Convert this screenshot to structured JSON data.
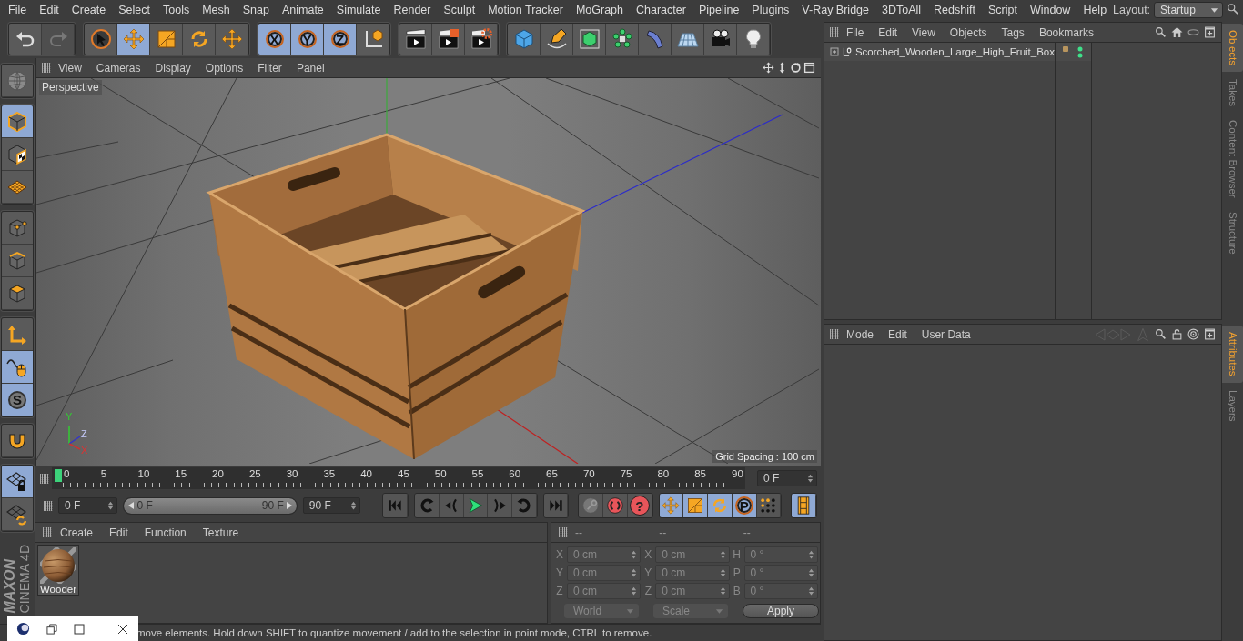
{
  "menu_bar": {
    "items": [
      "File",
      "Edit",
      "Create",
      "Select",
      "Tools",
      "Mesh",
      "Snap",
      "Animate",
      "Simulate",
      "Render",
      "Sculpt",
      "Motion Tracker",
      "MoGraph",
      "Character",
      "Pipeline",
      "Plugins",
      "V-Ray Bridge",
      "3DToAll",
      "Redshift",
      "Script",
      "Window",
      "Help"
    ],
    "layout_label": "Layout:",
    "layout_value": "Startup"
  },
  "toolbar": {
    "groups": [
      {
        "tools": [
          {
            "kind": "undo",
            "selected": false,
            "disabled": false
          },
          {
            "kind": "redo",
            "selected": false,
            "disabled": true
          }
        ]
      },
      {
        "tools": [
          {
            "kind": "select",
            "selected": false,
            "disabled": false
          },
          {
            "kind": "move",
            "selected": true,
            "disabled": false
          },
          {
            "kind": "scale",
            "selected": false,
            "disabled": false
          },
          {
            "kind": "rotate",
            "selected": false,
            "disabled": false
          },
          {
            "kind": "recent",
            "selected": false,
            "disabled": false
          }
        ]
      },
      {
        "tools": [
          {
            "kind": "axis",
            "label": "X",
            "selected": true,
            "disabled": false
          },
          {
            "kind": "axis",
            "label": "Y",
            "selected": true,
            "disabled": false
          },
          {
            "kind": "axis",
            "label": "Z",
            "selected": true,
            "disabled": false
          },
          {
            "kind": "coord",
            "selected": false,
            "disabled": false
          }
        ]
      },
      {
        "tools": [
          {
            "kind": "render",
            "selected": false,
            "disabled": false
          },
          {
            "kind": "render-viewer",
            "selected": false,
            "disabled": false
          },
          {
            "kind": "render-settings",
            "selected": false,
            "disabled": false
          }
        ]
      },
      {
        "tools": [
          {
            "kind": "cube",
            "selected": false,
            "disabled": false
          },
          {
            "kind": "pen",
            "selected": false,
            "disabled": false
          },
          {
            "kind": "subdiv",
            "selected": false,
            "disabled": false
          },
          {
            "kind": "cloner",
            "selected": false,
            "disabled": false
          },
          {
            "kind": "deformer",
            "selected": false,
            "disabled": false
          },
          {
            "kind": "floor",
            "selected": false,
            "disabled": false
          },
          {
            "kind": "camera",
            "selected": false,
            "disabled": false
          },
          {
            "kind": "light",
            "selected": false,
            "disabled": false
          }
        ]
      }
    ]
  },
  "left_toolbar": {
    "groups": [
      {
        "tools": [
          {
            "kind": "make-editable",
            "selected": false
          }
        ]
      },
      {
        "tools": [
          {
            "kind": "model",
            "selected": true
          },
          {
            "kind": "texture",
            "selected": false
          },
          {
            "kind": "workplane",
            "selected": false
          }
        ]
      },
      {
        "tools": [
          {
            "kind": "points",
            "selected": false
          },
          {
            "kind": "edges",
            "selected": false
          },
          {
            "kind": "polygons",
            "selected": false
          }
        ]
      },
      {
        "tools": [
          {
            "kind": "axis-mode",
            "selected": false
          },
          {
            "kind": "tweak",
            "selected": true
          },
          {
            "kind": "solo",
            "label": "S",
            "selected": true
          }
        ]
      },
      {
        "tools": [
          {
            "kind": "snap",
            "selected": false
          }
        ]
      },
      {
        "tools": [
          {
            "kind": "workplane-lock",
            "selected": true
          },
          {
            "kind": "workplane-snap",
            "selected": false
          }
        ]
      }
    ]
  },
  "logo": {
    "brand": "MAXON",
    "product": "CINEMA 4D"
  },
  "viewport": {
    "menu": [
      "View",
      "Cameras",
      "Display",
      "Options",
      "Filter",
      "Panel"
    ],
    "camera": "Perspective",
    "grid_spacing": "Grid Spacing : 100 cm",
    "axis_labels": [
      "Y",
      "Z",
      "X"
    ]
  },
  "timeline": {
    "ticks": [
      "0",
      "5",
      "10",
      "15",
      "20",
      "25",
      "30",
      "35",
      "40",
      "45",
      "50",
      "55",
      "60",
      "65",
      "70",
      "75",
      "80",
      "85",
      "90"
    ],
    "level": 0,
    "current_frame": "0 F"
  },
  "playback": {
    "start": "0 F",
    "range": {
      "start": "0 F",
      "end": "90 F",
      "level": 1
    },
    "end": "90 F",
    "groups": [
      {
        "buttons": [
          {
            "kind": "go-start",
            "selected": false
          }
        ]
      },
      {
        "buttons": [
          {
            "kind": "prev-key",
            "selected": false
          },
          {
            "kind": "prev-frame",
            "selected": false
          },
          {
            "kind": "play",
            "selected": false
          },
          {
            "kind": "next-frame",
            "selected": false
          },
          {
            "kind": "next-key",
            "selected": false
          }
        ]
      },
      {
        "buttons": [
          {
            "kind": "go-end",
            "selected": false
          }
        ]
      },
      {
        "buttons": [
          {
            "kind": "keyframe",
            "selected": false
          },
          {
            "kind": "autokey",
            "selected": false
          },
          {
            "kind": "help",
            "label": "?",
            "selected": false
          }
        ]
      },
      {
        "buttons": [
          {
            "kind": "move",
            "selected": true
          },
          {
            "kind": "scale",
            "selected": true
          },
          {
            "kind": "rotate",
            "selected": true
          },
          {
            "kind": "param",
            "label": "P",
            "selected": true
          },
          {
            "kind": "points-grid",
            "selected": false
          }
        ]
      },
      {
        "buttons": [
          {
            "kind": "film",
            "selected": true
          }
        ]
      }
    ]
  },
  "materials": {
    "menu": [
      "Create",
      "Edit",
      "Function",
      "Texture"
    ],
    "items": [
      {
        "name": "Wooder"
      }
    ]
  },
  "coordinates": {
    "disabled": true,
    "headers": [
      "--",
      "--",
      "--"
    ],
    "rows": [
      {
        "position_axis": "X",
        "position": "0 cm",
        "size_axis": "X",
        "size": "0 cm",
        "rotation_axis": "H",
        "rotation": "0 °"
      },
      {
        "position_axis": "Y",
        "position": "0 cm",
        "size_axis": "Y",
        "size": "0 cm",
        "rotation_axis": "P",
        "rotation": "0 °"
      },
      {
        "position_axis": "Z",
        "position": "0 cm",
        "size_axis": "Z",
        "size": "0 cm",
        "rotation_axis": "B",
        "rotation": "0 °"
      }
    ],
    "coordinate_mode": "World",
    "transform_mode": "Scale",
    "apply": "Apply"
  },
  "status_bar": "move elements. Hold down SHIFT to quantize movement / add to the selection in point mode, CTRL to remove.",
  "object_manager": {
    "menu": [
      "File",
      "Edit",
      "View",
      "Objects",
      "Tags",
      "Bookmarks"
    ],
    "objects": [
      {
        "name": "Scorched_Wooden_Large_High_Fruit_Box",
        "expanded": false,
        "selected": false
      }
    ]
  },
  "attributes": {
    "menu": [
      "Mode",
      "Edit",
      "User Data"
    ]
  },
  "side_tabs_top": [
    {
      "label": "Objects",
      "selected": true
    },
    {
      "label": "Takes",
      "selected": false
    },
    {
      "label": "Content Browser",
      "selected": false
    },
    {
      "label": "Structure",
      "selected": false
    }
  ],
  "side_tabs_bottom": [
    {
      "label": "Attributes",
      "selected": true
    },
    {
      "label": "Layers",
      "selected": false
    }
  ]
}
